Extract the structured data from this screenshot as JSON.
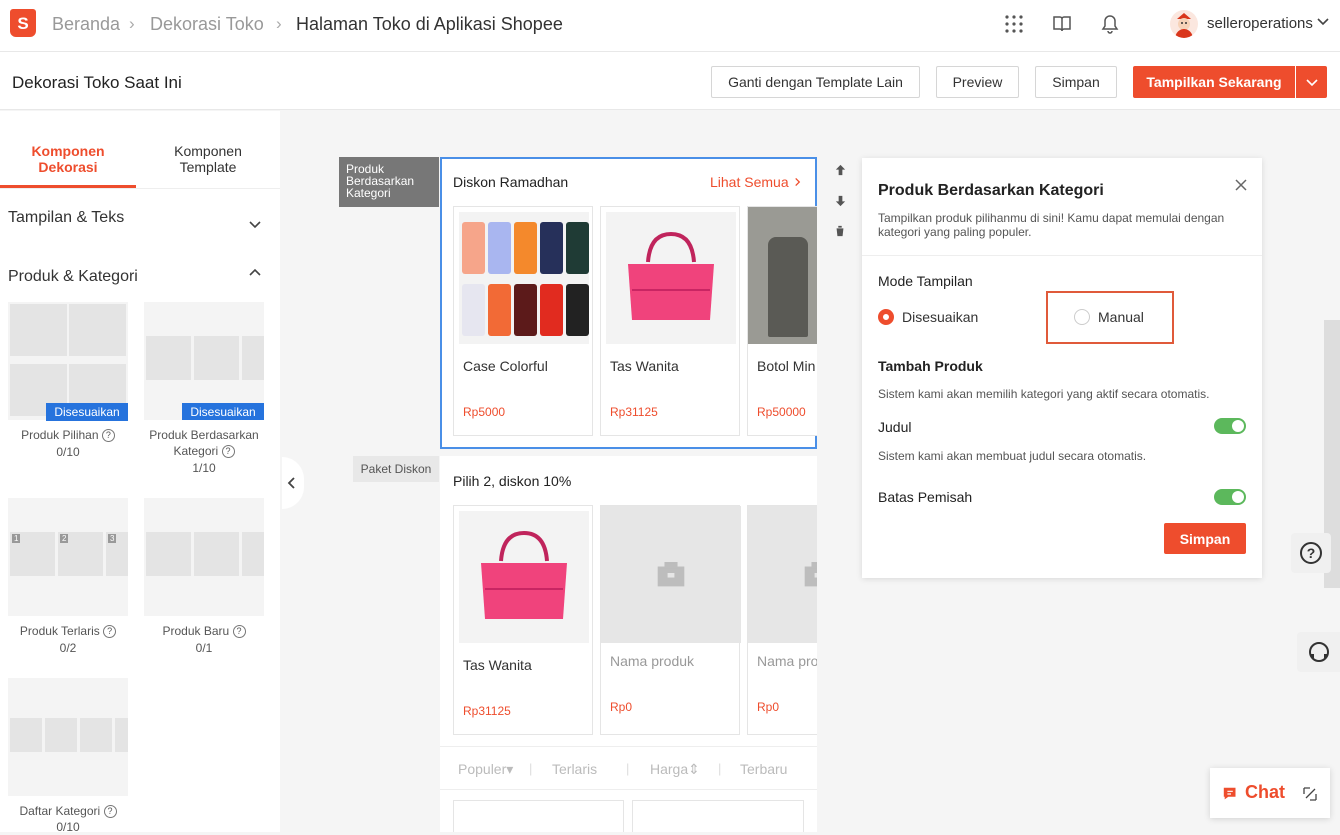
{
  "nav": {
    "logo": "S",
    "breadcrumb": [
      "Beranda",
      "Dekorasi Toko",
      "Halaman Toko di Aplikasi Shopee"
    ],
    "user": "selleroperations",
    "icons": [
      "apps-grid-icon",
      "book-icon",
      "bell-icon"
    ]
  },
  "header": {
    "title": "Dekorasi Toko Saat Ini",
    "btn_template": "Ganti dengan Template Lain",
    "btn_preview": "Preview",
    "btn_save": "Simpan",
    "btn_publish": "Tampilkan Sekarang"
  },
  "left": {
    "tabs": [
      "Komponen\nDekorasi",
      "Komponen\nTemplate"
    ],
    "sections": [
      "Tampilan & Teks",
      "Produk & Kategori"
    ],
    "components": [
      {
        "name": "Produk Pilihan",
        "count": "0/10",
        "badge": "Disesuaikan"
      },
      {
        "name": "Produk Berdasarkan Kategori",
        "count": "1/10",
        "badge": "Disesuaikan"
      },
      {
        "name": "Produk Terlaris",
        "count": "0/2"
      },
      {
        "name": "Produk Baru",
        "count": "0/1"
      },
      {
        "name": "Daftar Kategori",
        "count": "0/10"
      }
    ],
    "rank_numbers": [
      "1",
      "2",
      "3"
    ]
  },
  "canvas": {
    "section1_label": "Produk Berdasarkan Kategori",
    "section2_label": "Paket Diskon",
    "card1": {
      "title": "Diskon Ramadhan",
      "see_all": "Lihat Semua",
      "products": [
        {
          "name": "Case Colorful",
          "price": "Rp5000"
        },
        {
          "name": "Tas Wanita",
          "price": "Rp31125"
        },
        {
          "name": "Botol Min",
          "price": "Rp50000"
        }
      ]
    },
    "card2": {
      "title": "Pilih 2, diskon 10%",
      "products": [
        {
          "name": "Tas Wanita",
          "price": "Rp31125"
        },
        {
          "name": "Nama produk",
          "price": "Rp0"
        },
        {
          "name": "Nama pro",
          "price": "Rp0"
        }
      ]
    },
    "sort_tabs": [
      "Populer",
      "Terlaris",
      "Harga",
      "Terbaru"
    ]
  },
  "panel": {
    "title": "Produk Berdasarkan Kategori",
    "desc": "Tampilkan produk pilihanmu di sini! Kamu dapat memulai dengan kategori yang paling populer.",
    "mode_label": "Mode Tampilan",
    "mode_options": [
      "Disesuaikan",
      "Manual"
    ],
    "mode_selected": "Disesuaikan",
    "add_label": "Tambah Produk",
    "add_desc": "Sistem kami akan memilih kategori yang aktif secara otomatis.",
    "title_label": "Judul",
    "title_desc": "Sistem kami akan membuat judul secara otomatis.",
    "divider_label": "Batas Pemisah",
    "title_toggle_on": true,
    "divider_toggle_on": true,
    "save": "Simpan"
  },
  "widgets": {
    "chat": "Chat",
    "help": "?"
  },
  "colors": {
    "brand": "#ee4d2d",
    "blue": "#2673dd",
    "toggle": "#5cb85c"
  }
}
